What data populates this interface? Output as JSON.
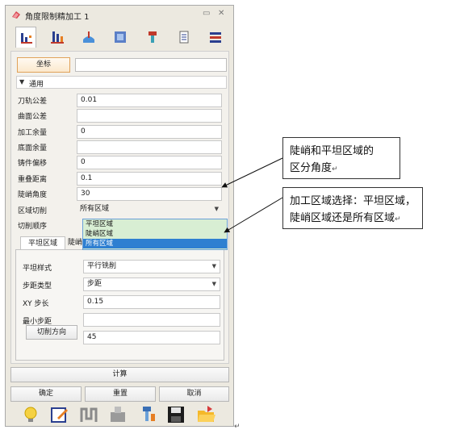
{
  "window": {
    "title": "角度限制精加工 1",
    "pin_glyph": "▭",
    "close_glyph": "✕"
  },
  "toolbar": {
    "icons": [
      "layers-tool-icon",
      "bars-tool-icon",
      "surface-tool-icon",
      "view-tool-icon",
      "tool-holder-icon",
      "document-icon",
      "settings-stack-icon"
    ]
  },
  "coord": {
    "button": "坐标",
    "value": ""
  },
  "general": {
    "section_label": "通用",
    "fields": [
      {
        "label": "刀轨公差",
        "value": "0.01"
      },
      {
        "label": "曲面公差",
        "value": ""
      },
      {
        "label": "加工余量",
        "value": "0"
      },
      {
        "label": "底面余量",
        "value": ""
      },
      {
        "label": "铸件偏移",
        "value": "0"
      },
      {
        "label": "重叠距离",
        "value": "0.1"
      },
      {
        "label": "陡峭角度",
        "value": "30"
      }
    ],
    "region_label": "区域切削",
    "region_value": "所有区域",
    "order_label": "切削顺序",
    "dropdown_options": [
      "平坦区域",
      "陡峭区域",
      "所有区域"
    ],
    "dropdown_selected_index": 2
  },
  "subtabs": {
    "flat": "平坦区域",
    "steep": "陡峭区域"
  },
  "flat": {
    "style_label": "平坦样式",
    "style_value": "平行铣削",
    "step_type_label": "步距类型",
    "step_type_value": "步距",
    "xy_step_label": "XY 步长",
    "xy_step_value": "0.15",
    "min_step_label": "最小步距",
    "min_step_value": "",
    "direction_button": "切削方向",
    "direction_value": "45"
  },
  "actions": {
    "calculate": "计算",
    "ok": "确定",
    "reset": "重置",
    "cancel": "取消"
  },
  "bottom_icons": [
    "bulb-icon",
    "edit-icon",
    "toolpath-icon",
    "simulate-icon",
    "tool-icon",
    "save-icon",
    "open-folder-icon"
  ],
  "callouts": {
    "top": [
      "陡峭和平坦区域的",
      "区分角度"
    ],
    "bottom": [
      "加工区域选择：平坦区域，",
      "陡峭区域还是所有区域"
    ],
    "return_mark": "↵"
  }
}
